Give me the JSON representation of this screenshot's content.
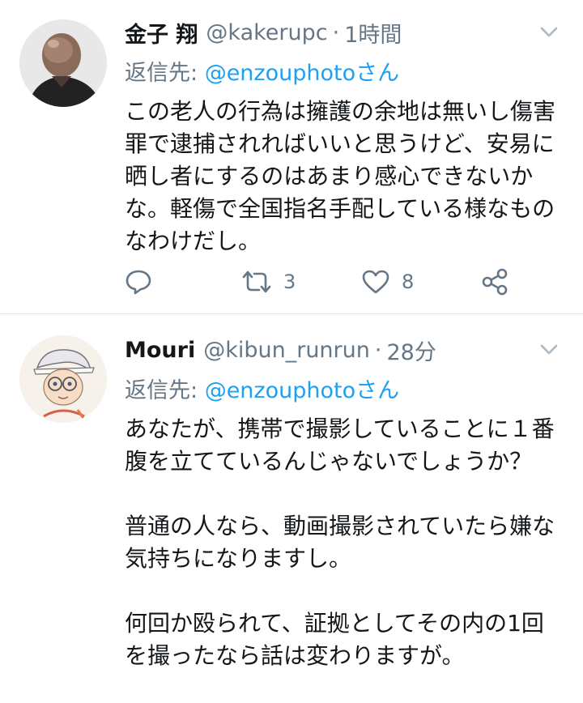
{
  "tweets": [
    {
      "name": "金子 翔",
      "handle": "@kakerupc",
      "separator": "·",
      "time": "1時間",
      "reply_prefix": "返信先: ",
      "reply_to": "@enzouphotoさん",
      "text": "この老人の行為は擁護の余地は無いし傷害罪で逮捕されればいいと思うけど、安易に晒し者にするのはあまり感心できないかな。軽傷で全国指名手配している様なものなわけだし。",
      "retweets": "3",
      "likes": "8",
      "avatar_icon": "bald-man-photo"
    },
    {
      "name": "Mouri",
      "handle": "@kibun_runrun",
      "separator": "·",
      "time": "28分",
      "reply_prefix": "返信先: ",
      "reply_to": "@enzouphotoさん",
      "text": "あなたが、携帯で撮影していることに１番腹を立てているんじゃないでしょうか？\n\n普通の人なら、動画撮影されていたら嫌な気持ちになりますし。\n\n何回か殴られて、証拠としてその内の1回を撮ったなら話は変わりますが。",
      "avatar_icon": "anime-detective-drawing"
    }
  ],
  "colors": {
    "accent": "#1da1f2",
    "muted": "#657786",
    "text": "#14171a",
    "divider": "#e1e8ed"
  },
  "icons": {
    "reply": "reply-icon",
    "retweet": "retweet-icon",
    "like": "heart-icon",
    "share": "share-icon",
    "menu": "chevron-down-icon"
  }
}
